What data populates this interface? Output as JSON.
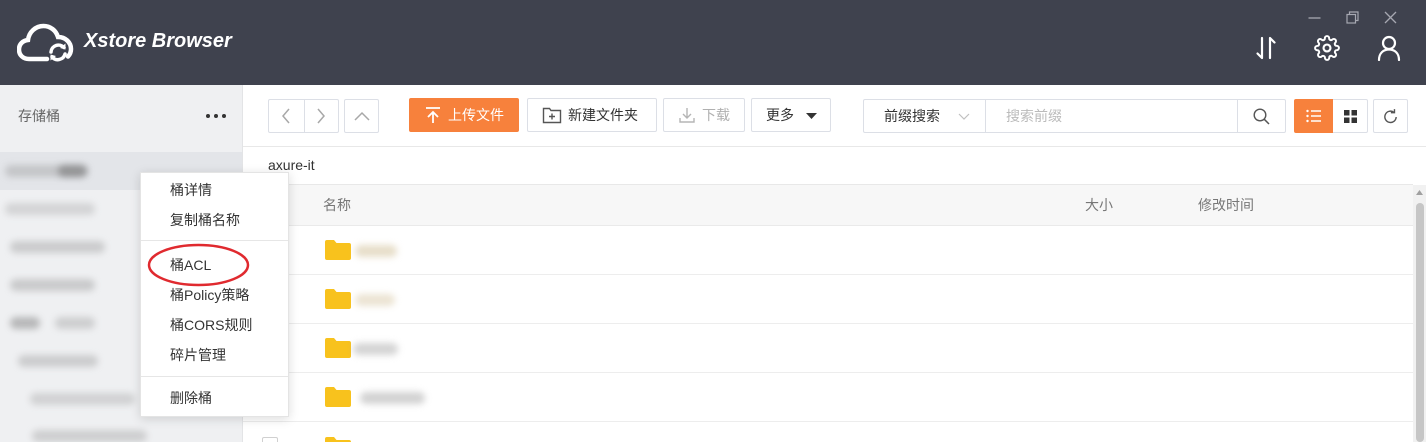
{
  "app": {
    "title": "Xstore Browser"
  },
  "icons": {
    "logo": "cloud-sync-icon",
    "window": [
      "minimize-icon",
      "restore-icon",
      "close-icon"
    ],
    "header": [
      "transfer-icon",
      "gear-icon",
      "user-icon"
    ],
    "toolbar": [
      "chevron-left-icon",
      "chevron-right-icon",
      "chevron-up-icon",
      "upload-icon",
      "folder-plus-icon",
      "download-icon",
      "caret-down-icon",
      "search-icon",
      "list-view-icon",
      "grid-view-icon",
      "refresh-icon"
    ]
  },
  "sidebar": {
    "title": "存储桶",
    "menu_icon": "more-icon"
  },
  "context_menu": {
    "groups": [
      [
        "桶详情",
        "复制桶名称"
      ],
      [
        "桶ACL",
        "桶Policy策略",
        "桶CORS规则",
        "碎片管理"
      ],
      [
        "删除桶"
      ]
    ]
  },
  "toolbar": {
    "upload_label": "上传文件",
    "new_folder_label": "新建文件夹",
    "download_label": "下载",
    "more_label": "更多",
    "search_mode": "前缀搜索",
    "search_placeholder": "搜索前缀",
    "active_view": "list-view-icon"
  },
  "breadcrumb": {
    "path": "axure-it"
  },
  "table": {
    "columns": {
      "name": "名称",
      "size": "大小",
      "modified": "修改时间"
    },
    "rows": [
      {
        "icon": "folder-icon"
      },
      {
        "icon": "folder-icon"
      },
      {
        "icon": "folder-icon"
      },
      {
        "icon": "folder-icon"
      },
      {
        "icon": "folder-icon"
      }
    ]
  },
  "colors": {
    "header_bg": "#3f424e",
    "accent": "#f7813c",
    "sidebar_bg": "#eff0f2",
    "folder": "#f8c21d",
    "annotation": "#e02a2f"
  }
}
